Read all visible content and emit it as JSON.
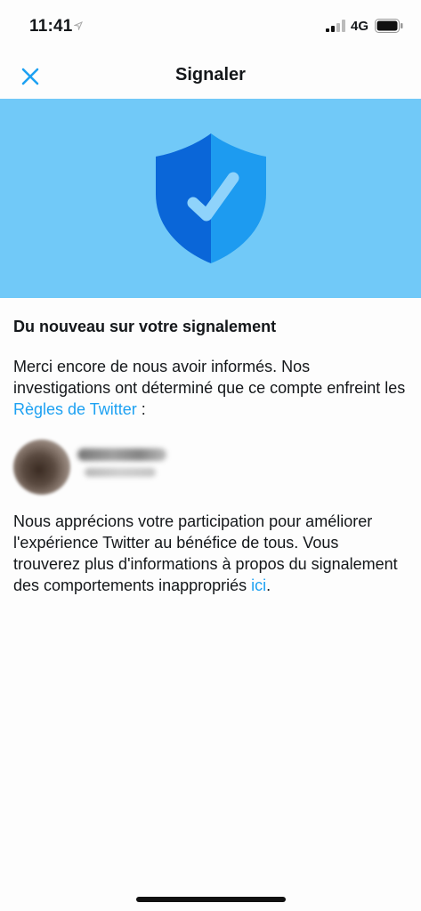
{
  "status_bar": {
    "time": "11:41",
    "network": "4G"
  },
  "nav": {
    "title": "Signaler",
    "close_icon": "close-icon"
  },
  "colors": {
    "accent": "#1da1f2",
    "hero_bg": "#71c9f8",
    "shield_dark": "#0a66d8",
    "shield_light": "#1d9bf0"
  },
  "content": {
    "headline": "Du nouveau sur votre signalement",
    "para1_text": "Merci encore de nous avoir informés. Nos investigations ont déterminé que ce compte enfreint les ",
    "para1_link": "Règles de Twitter",
    "para1_end": " :",
    "para2_text": "Nous apprécions votre participation pour améliorer l'expérience Twitter au bénéfice de tous. Vous trouverez plus d'informations à propos du signalement des comportements inappropriés ",
    "para2_link": "ici",
    "para2_end": "."
  }
}
